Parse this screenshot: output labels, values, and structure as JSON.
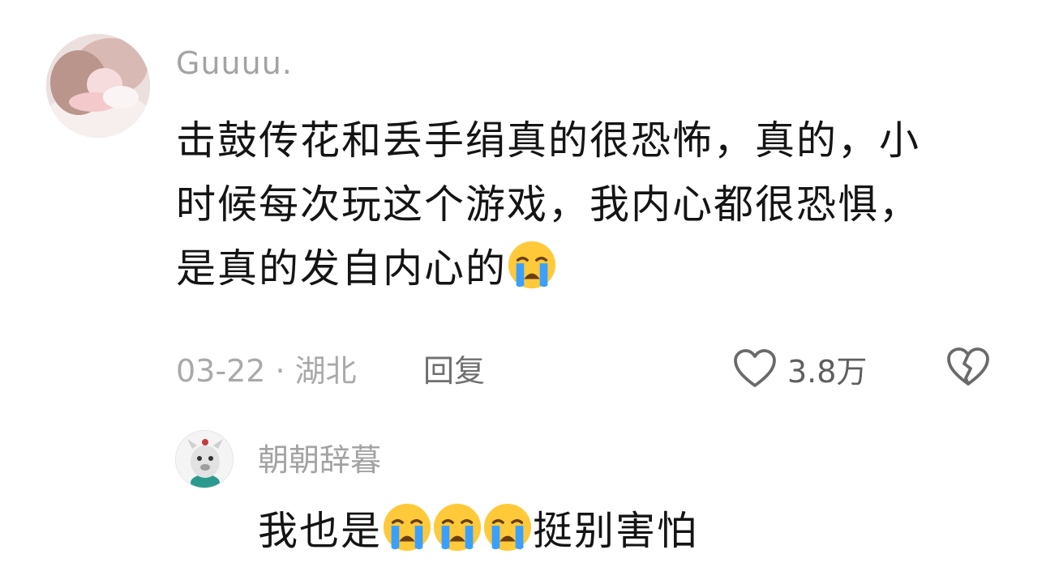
{
  "comment": {
    "username": "Guuuu.",
    "text_lines": [
      "击鼓传花和丢手绢真的很恐怖，真的，小",
      "时候每次玩这个游戏，我内心都很恐惧，",
      "是真的发自内心的"
    ],
    "trailing_emoji": "loudly-crying-face",
    "date_location": "03-22 · 湖北",
    "reply_label": "回复",
    "like_count": "3.8万",
    "like_icon": "heart-outline-icon",
    "dislike_icon": "broken-heart-icon"
  },
  "reply": {
    "username": "朝朝辞暮",
    "text_before": "我也是",
    "emoji": "loudly-crying-face",
    "emoji_count": 3,
    "text_after": "挺别害怕"
  },
  "colors": {
    "username": "#a3a3a3",
    "text": "#141414",
    "meta": "#a9a9a9",
    "icon": "#6a6a6a"
  }
}
